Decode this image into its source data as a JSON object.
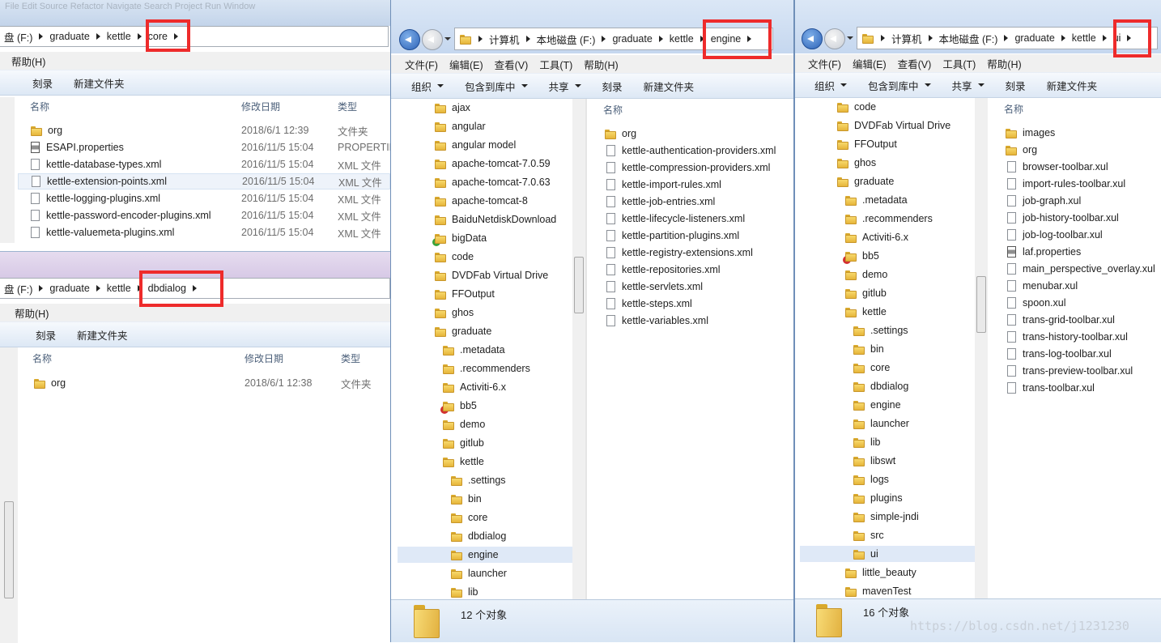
{
  "core_window": {
    "faded_menu": "File  Edit  Source  Refactor  Navigate  Search  Project  Run  Window",
    "address": [
      "盘 (F:)",
      "graduate",
      "kettle",
      "core"
    ],
    "menu": [
      "帮助(H)"
    ],
    "toolbar": [
      "刻录",
      "新建文件夹"
    ],
    "columns": {
      "name": "名称",
      "date": "修改日期",
      "type": "类型"
    },
    "rows": [
      {
        "name": "org",
        "date": "2018/6/1 12:39",
        "type": "文件夹",
        "icon": "folder-icon"
      },
      {
        "name": "ESAPI.properties",
        "date": "2016/11/5 15:04",
        "type": "PROPERTIE",
        "icon": "properties-file-icon"
      },
      {
        "name": "kettle-database-types.xml",
        "date": "2016/11/5 15:04",
        "type": "XML 文件",
        "icon": "xml-file-icon"
      },
      {
        "name": "kettle-extension-points.xml",
        "date": "2016/11/5 15:04",
        "type": "XML 文件",
        "icon": "xml-file-icon"
      },
      {
        "name": "kettle-logging-plugins.xml",
        "date": "2016/11/5 15:04",
        "type": "XML 文件",
        "icon": "xml-file-icon"
      },
      {
        "name": "kettle-password-encoder-plugins.xml",
        "date": "2016/11/5 15:04",
        "type": "XML 文件",
        "icon": "xml-file-icon"
      },
      {
        "name": "kettle-valuemeta-plugins.xml",
        "date": "2016/11/5 15:04",
        "type": "XML 文件",
        "icon": "xml-file-icon"
      }
    ]
  },
  "dbdialog_window": {
    "address": [
      "盘 (F:)",
      "graduate",
      "kettle",
      "dbdialog"
    ],
    "menu": [
      "帮助(H)"
    ],
    "toolbar": [
      "刻录",
      "新建文件夹"
    ],
    "columns": {
      "name": "名称",
      "date": "修改日期",
      "type": "类型"
    },
    "rows": [
      {
        "name": "org",
        "date": "2018/6/1 12:38",
        "type": "文件夹",
        "icon": "folder-icon"
      }
    ]
  },
  "engine_window": {
    "address": [
      "计算机",
      "本地磁盘 (F:)",
      "graduate",
      "kettle",
      "engine"
    ],
    "menu": [
      "文件(F)",
      "编辑(E)",
      "查看(V)",
      "工具(T)",
      "帮助(H)"
    ],
    "toolbar": [
      "组织",
      "包含到库中",
      "共享",
      "刻录",
      "新建文件夹"
    ],
    "tree": [
      {
        "label": "ajax",
        "indent": 0
      },
      {
        "label": "angular",
        "indent": 0
      },
      {
        "label": "angular model",
        "indent": 0
      },
      {
        "label": "apache-tomcat-7.0.59",
        "indent": 0
      },
      {
        "label": "apache-tomcat-7.0.63",
        "indent": 0
      },
      {
        "label": "apache-tomcat-8",
        "indent": 0
      },
      {
        "label": "BaiduNetdiskDownload",
        "indent": 0
      },
      {
        "label": "bigData",
        "indent": 0,
        "badge": "ok"
      },
      {
        "label": "code",
        "indent": 0
      },
      {
        "label": "DVDFab Virtual Drive",
        "indent": 0
      },
      {
        "label": "FFOutput",
        "indent": 0
      },
      {
        "label": "ghos",
        "indent": 0
      },
      {
        "label": "graduate",
        "indent": 0
      },
      {
        "label": ".metadata",
        "indent": 1
      },
      {
        "label": ".recommenders",
        "indent": 1
      },
      {
        "label": "Activiti-6.x",
        "indent": 1
      },
      {
        "label": "bb5",
        "indent": 1,
        "badge": "err"
      },
      {
        "label": "demo",
        "indent": 1
      },
      {
        "label": "gitlub",
        "indent": 1
      },
      {
        "label": "kettle",
        "indent": 1
      },
      {
        "label": ".settings",
        "indent": 2
      },
      {
        "label": "bin",
        "indent": 2
      },
      {
        "label": "core",
        "indent": 2
      },
      {
        "label": "dbdialog",
        "indent": 2
      },
      {
        "label": "engine",
        "indent": 2,
        "selected": true
      },
      {
        "label": "launcher",
        "indent": 2
      },
      {
        "label": "lib",
        "indent": 2
      }
    ],
    "list_header": "名称",
    "files": [
      {
        "name": "org",
        "icon": "folder-icon"
      },
      {
        "name": "kettle-authentication-providers.xml",
        "icon": "xml-file-icon"
      },
      {
        "name": "kettle-compression-providers.xml",
        "icon": "xml-file-icon"
      },
      {
        "name": "kettle-import-rules.xml",
        "icon": "xml-file-icon"
      },
      {
        "name": "kettle-job-entries.xml",
        "icon": "xml-file-icon"
      },
      {
        "name": "kettle-lifecycle-listeners.xml",
        "icon": "xml-file-icon"
      },
      {
        "name": "kettle-partition-plugins.xml",
        "icon": "xml-file-icon"
      },
      {
        "name": "kettle-registry-extensions.xml",
        "icon": "xml-file-icon"
      },
      {
        "name": "kettle-repositories.xml",
        "icon": "xml-file-icon"
      },
      {
        "name": "kettle-servlets.xml",
        "icon": "xml-file-icon"
      },
      {
        "name": "kettle-steps.xml",
        "icon": "xml-file-icon"
      },
      {
        "name": "kettle-variables.xml",
        "icon": "xml-file-icon"
      }
    ],
    "status": "12 个对象"
  },
  "ui_window": {
    "address": [
      "计算机",
      "本地磁盘 (F:)",
      "graduate",
      "kettle",
      "ui"
    ],
    "menu": [
      "文件(F)",
      "编辑(E)",
      "查看(V)",
      "工具(T)",
      "帮助(H)"
    ],
    "toolbar": [
      "组织",
      "包含到库中",
      "共享",
      "刻录",
      "新建文件夹"
    ],
    "tree": [
      {
        "label": "code",
        "indent": 0
      },
      {
        "label": "DVDFab Virtual Drive",
        "indent": 0
      },
      {
        "label": "FFOutput",
        "indent": 0
      },
      {
        "label": "ghos",
        "indent": 0
      },
      {
        "label": "graduate",
        "indent": 0
      },
      {
        "label": ".metadata",
        "indent": 1
      },
      {
        "label": ".recommenders",
        "indent": 1
      },
      {
        "label": "Activiti-6.x",
        "indent": 1
      },
      {
        "label": "bb5",
        "indent": 1,
        "badge": "err"
      },
      {
        "label": "demo",
        "indent": 1
      },
      {
        "label": "gitlub",
        "indent": 1
      },
      {
        "label": "kettle",
        "indent": 1
      },
      {
        "label": ".settings",
        "indent": 2
      },
      {
        "label": "bin",
        "indent": 2
      },
      {
        "label": "core",
        "indent": 2
      },
      {
        "label": "dbdialog",
        "indent": 2
      },
      {
        "label": "engine",
        "indent": 2
      },
      {
        "label": "launcher",
        "indent": 2
      },
      {
        "label": "lib",
        "indent": 2
      },
      {
        "label": "libswt",
        "indent": 2
      },
      {
        "label": "logs",
        "indent": 2
      },
      {
        "label": "plugins",
        "indent": 2
      },
      {
        "label": "simple-jndi",
        "indent": 2
      },
      {
        "label": "src",
        "indent": 2
      },
      {
        "label": "ui",
        "indent": 2,
        "selected": true
      },
      {
        "label": "little_beauty",
        "indent": 1
      },
      {
        "label": "mavenTest",
        "indent": 1
      }
    ],
    "list_header": "名称",
    "files": [
      {
        "name": "images",
        "icon": "folder-icon"
      },
      {
        "name": "org",
        "icon": "folder-icon"
      },
      {
        "name": "browser-toolbar.xul",
        "icon": "file-icon"
      },
      {
        "name": "import-rules-toolbar.xul",
        "icon": "file-icon"
      },
      {
        "name": "job-graph.xul",
        "icon": "file-icon"
      },
      {
        "name": "job-history-toolbar.xul",
        "icon": "file-icon"
      },
      {
        "name": "job-log-toolbar.xul",
        "icon": "file-icon"
      },
      {
        "name": "laf.properties",
        "icon": "properties-file-icon"
      },
      {
        "name": "main_perspective_overlay.xul",
        "icon": "file-icon"
      },
      {
        "name": "menubar.xul",
        "icon": "file-icon"
      },
      {
        "name": "spoon.xul",
        "icon": "file-icon"
      },
      {
        "name": "trans-grid-toolbar.xul",
        "icon": "file-icon"
      },
      {
        "name": "trans-history-toolbar.xul",
        "icon": "file-icon"
      },
      {
        "name": "trans-log-toolbar.xul",
        "icon": "file-icon"
      },
      {
        "name": "trans-preview-toolbar.xul",
        "icon": "file-icon"
      },
      {
        "name": "trans-toolbar.xul",
        "icon": "file-icon"
      }
    ],
    "status": "16 个对象"
  },
  "watermark": "https://blog.csdn.net/j1231230",
  "colors": {
    "highlight_box": "#ee2b2b",
    "selection": "#dfe9f7"
  }
}
